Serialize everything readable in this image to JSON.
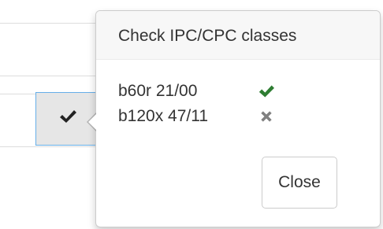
{
  "popover": {
    "title": "Check IPC/CPC classes",
    "classes": [
      {
        "code": "b60r 21/00",
        "status": "valid",
        "icon": "check-icon",
        "color": "#2e7d32"
      },
      {
        "code": "b120x 47/11",
        "status": "invalid",
        "icon": "cross-icon",
        "color": "#808080"
      }
    ],
    "close_label": "Close"
  },
  "trigger": {
    "icon": "check-icon",
    "background": "#e6e6e6",
    "border_color": "#66afe9"
  }
}
